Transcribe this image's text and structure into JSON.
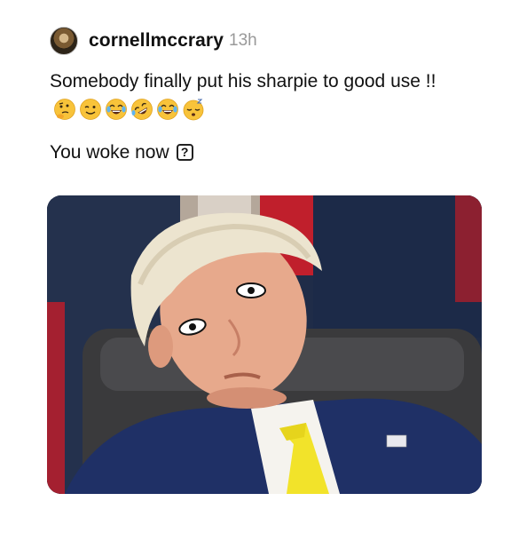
{
  "post": {
    "username": "cornellmccrary",
    "time": "13h",
    "caption_line1": "Somebody finally put his sharpie to good use !!",
    "emojis": [
      "thinking-face",
      "winking-face",
      "tears-of-joy",
      "rolling-laughing",
      "tears-of-joy",
      "sleeping-face"
    ],
    "caption_line2": "You woke now",
    "question_box": "?"
  },
  "colors": {
    "text": "#111111",
    "muted": "#999999",
    "suit": "#1e2f5c",
    "tie": "#f2e32a"
  }
}
